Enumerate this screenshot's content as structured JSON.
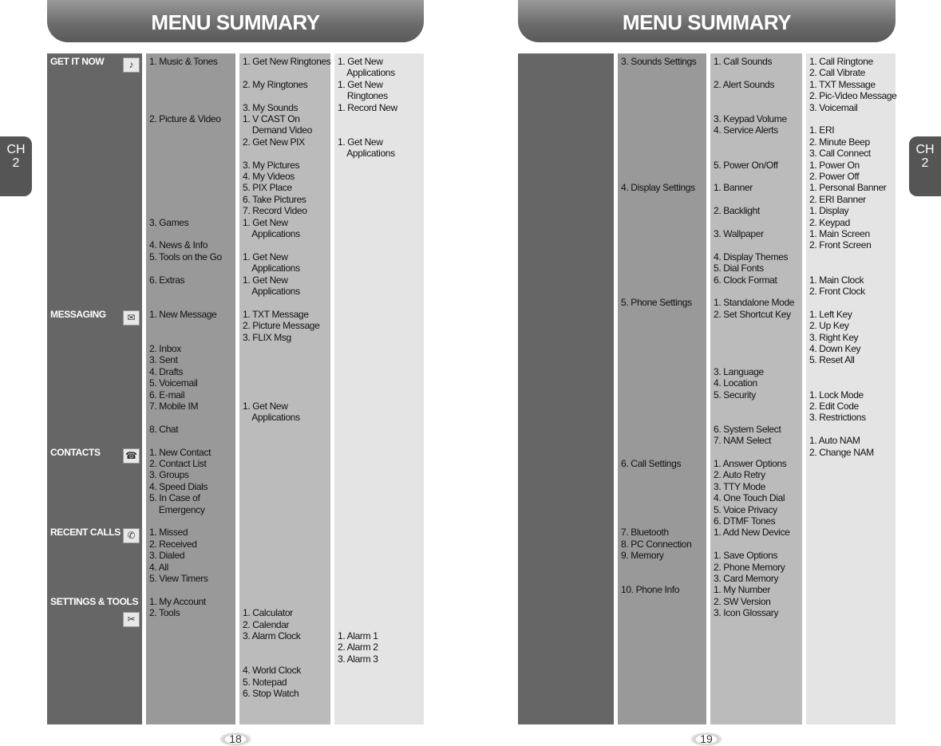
{
  "pages": [
    {
      "title": "MENU SUMMARY",
      "page_number": "18",
      "chapter_tab": "CH\n2",
      "columns": [
        {
          "color": "#666666",
          "categories": [
            {
              "label": "GET IT NOW",
              "row": 0,
              "icon": "get-it-now-icon",
              "glyph": "♪"
            },
            {
              "label": "MESSAGING",
              "row": 22,
              "icon": "messaging-icon",
              "glyph": "✉"
            },
            {
              "label": "CONTACTS",
              "row": 34,
              "icon": "contacts-icon",
              "glyph": "☎"
            },
            {
              "label": "RECENT CALLS",
              "row": 41,
              "icon": "recent-calls-icon",
              "glyph": "✆"
            },
            {
              "label": "SETTINGS & TOOLS",
              "row": 47,
              "icon": "settings-tools-icon",
              "glyph": "✂"
            }
          ]
        },
        {
          "color": "#999999",
          "lines": [
            "1. Music & Tones",
            "",
            "",
            "",
            "",
            "2. Picture & Video",
            "",
            "",
            "",
            "",
            "",
            "",
            "",
            "",
            "3. Games",
            "",
            "4. News & Info",
            "5. Tools on the Go",
            "",
            "6. Extras",
            "",
            "",
            "1. New Message",
            "",
            "",
            "2. Inbox",
            "3. Sent",
            "4. Drafts",
            "5. Voicemail",
            "6. E-mail",
            "7. Mobile IM",
            "",
            "8. Chat",
            "",
            "1. New Contact",
            "2. Contact List",
            "3. Groups",
            "4. Speed Dials",
            "5. In Case of",
            "    Emergency",
            "",
            "1. Missed",
            "2. Received",
            "3. Dialed",
            "4. All",
            "5. View Timers",
            "",
            "1. My Account",
            "2. Tools"
          ]
        },
        {
          "color": "#bbbbbb",
          "lines": [
            "1. Get New Ringtones",
            "",
            "2. My Ringtones",
            "",
            "3. My Sounds",
            "1. V CAST On",
            "    Demand Video",
            "2. Get New PIX",
            "",
            "3. My Pictures",
            "4. My Videos",
            "5. PIX Place",
            "6. Take Pictures",
            "7. Record Video",
            "1. Get New",
            "    Applications",
            "",
            "1. Get New",
            "    Applications",
            "1. Get New",
            "    Applications",
            "",
            "1. TXT Message",
            "2. Picture Message",
            "3. FLIX Msg",
            "",
            "",
            "",
            "",
            "",
            "1. Get New",
            "    Applications",
            "",
            "",
            "",
            "",
            "",
            "",
            "",
            "",
            "",
            "",
            "",
            "",
            "",
            "",
            "",
            "",
            "1. Calculator",
            "2. Calendar",
            "3. Alarm Clock",
            "",
            "",
            "4. World Clock",
            "5. Notepad",
            "6. Stop Watch"
          ]
        },
        {
          "color": "#e4e4e4",
          "lines": [
            "1. Get New",
            "    Applications",
            "1. Get New",
            "    Ringtones",
            "1. Record New",
            "",
            "",
            "1. Get New",
            "    Applications",
            "",
            "",
            "",
            "",
            "",
            "",
            "",
            "",
            "",
            "",
            "",
            "",
            "",
            "",
            "",
            "",
            "",
            "",
            "",
            "",
            "",
            "",
            "",
            "",
            "",
            "",
            "",
            "",
            "",
            "",
            "",
            "",
            "",
            "",
            "",
            "",
            "",
            "",
            "",
            "",
            "",
            "1. Alarm 1",
            "2. Alarm 2",
            "3. Alarm 3"
          ]
        }
      ]
    },
    {
      "title": "MENU SUMMARY",
      "page_number": "19",
      "chapter_tab": "CH\n2",
      "columns": [
        {
          "color": "#666666",
          "categories": []
        },
        {
          "color": "#999999",
          "lines": [
            "3. Sounds Settings",
            "",
            "",
            "",
            "",
            "",
            "",
            "",
            "",
            "",
            "",
            "4. Display Settings",
            "",
            "",
            "",
            "",
            "",
            "",
            "",
            "",
            "",
            "5. Phone Settings",
            "",
            "",
            "",
            "",
            "",
            "",
            "",
            "",
            "",
            "",
            "",
            "",
            "",
            "6. Call Settings",
            "",
            "",
            "",
            "",
            "",
            "7. Bluetooth",
            "8. PC Connection",
            "9. Memory",
            "",
            "",
            "10. Phone Info"
          ]
        },
        {
          "color": "#bbbbbb",
          "lines": [
            "1. Call Sounds",
            "",
            "2. Alert Sounds",
            "",
            "",
            "3. Keypad Volume",
            "4. Service Alerts",
            "",
            "",
            "5. Power On/Off",
            "",
            "1. Banner",
            "",
            "2. Backlight",
            "",
            "3. Wallpaper",
            "",
            "4. Display Themes",
            "5. Dial Fonts",
            "6. Clock Format",
            "",
            "1. Standalone Mode",
            "2. Set Shortcut Key",
            "",
            "",
            "",
            "",
            "3. Language",
            "4. Location",
            "5. Security",
            "",
            "",
            "6. System Select",
            "7. NAM Select",
            "",
            "1. Answer Options",
            "2. Auto Retry",
            "3. TTY Mode",
            "4. One Touch Dial",
            "5. Voice Privacy",
            "6. DTMF Tones",
            "1. Add New Device",
            "",
            "1. Save Options",
            "2. Phone Memory",
            "3. Card Memory",
            "1. My Number",
            "2. SW Version",
            "3. Icon Glossary"
          ]
        },
        {
          "color": "#e4e4e4",
          "lines": [
            "1. Call Ringtone",
            "2. Call Vibrate",
            "1. TXT Message",
            "2. Pic-Video Message",
            "3. Voicemail",
            "",
            "1. ERI",
            "2. Minute Beep",
            "3. Call Connect",
            "1. Power On",
            "2. Power Off",
            "1. Personal Banner",
            "2. ERI Banner",
            "1. Display",
            "2. Keypad",
            "1. Main Screen",
            "2. Front Screen",
            "",
            "",
            "1. Main Clock",
            "2. Front Clock",
            "",
            "1. Left Key",
            "2. Up Key",
            "3. Right Key",
            "4. Down Key",
            "5. Reset All",
            "",
            "",
            "1. Lock Mode",
            "2. Edit Code",
            "3. Restrictions",
            "",
            "1. Auto NAM",
            "2. Change NAM"
          ]
        }
      ]
    }
  ]
}
